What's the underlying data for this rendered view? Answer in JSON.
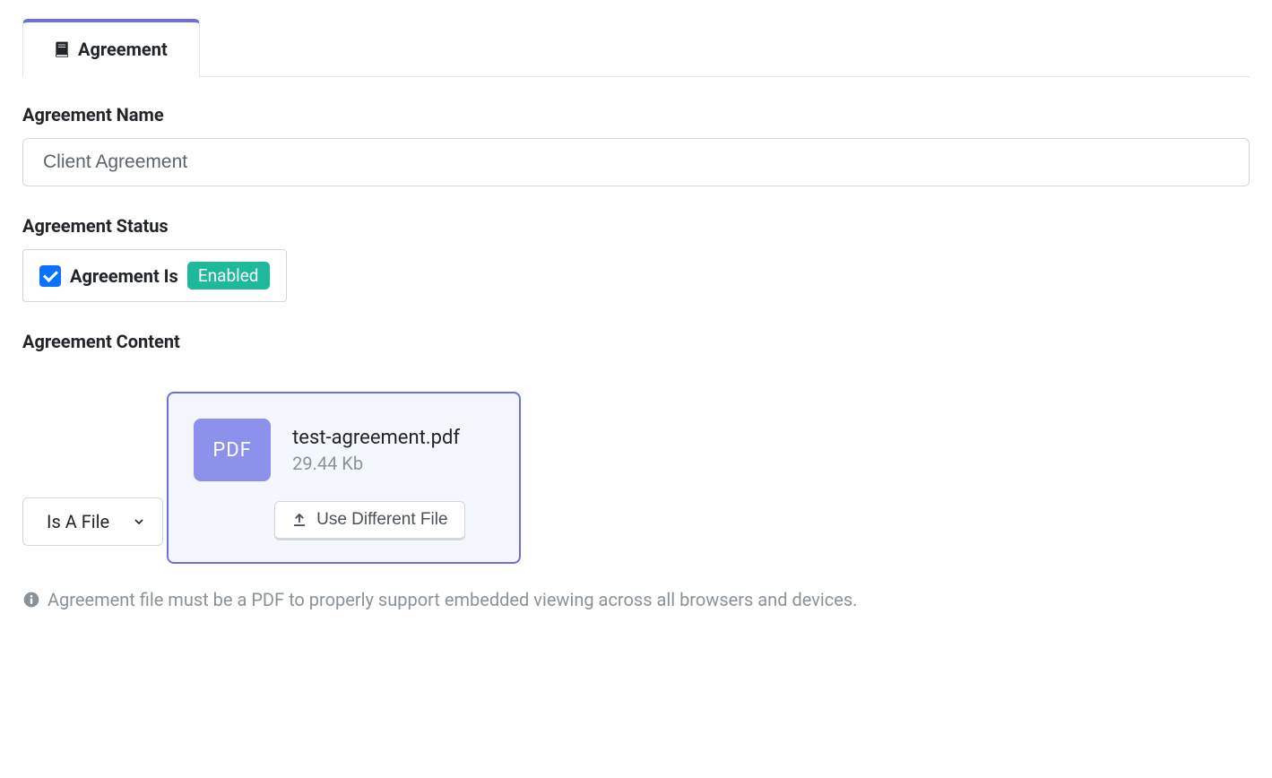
{
  "tabs": {
    "agreement": {
      "label": "Agreement"
    }
  },
  "form": {
    "name": {
      "label": "Agreement Name",
      "value": "Client Agreement"
    },
    "status": {
      "label": "Agreement Status",
      "checkbox_label": "Agreement Is",
      "badge": "Enabled",
      "checked": true
    },
    "content": {
      "label": "Agreement Content",
      "select_value": "Is A File"
    },
    "file": {
      "type_badge": "PDF",
      "name": "test-agreement.pdf",
      "size": "29.44 Kb",
      "replace_button": "Use Different File"
    },
    "info_note": "Agreement file must be a PDF to properly support embedded viewing across all browsers and devices."
  }
}
